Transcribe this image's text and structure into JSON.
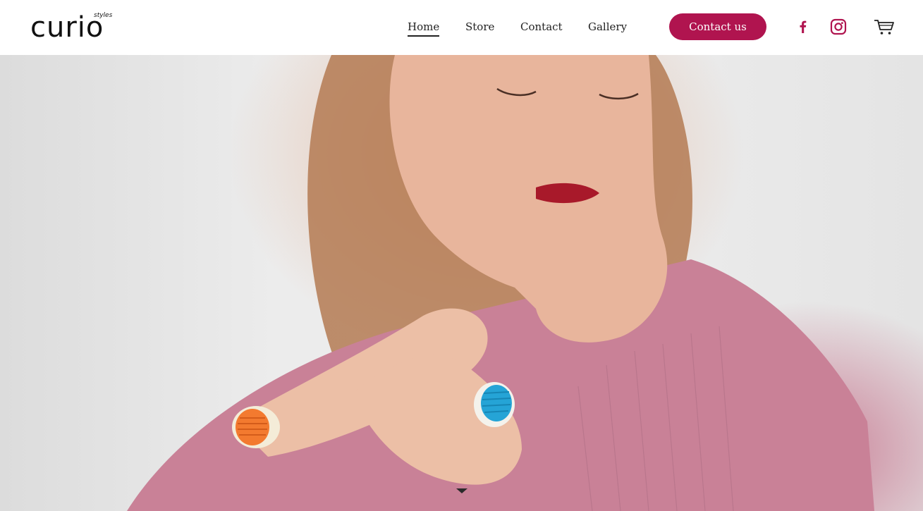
{
  "brand": {
    "logo_main": "curio",
    "logo_sub": "styles"
  },
  "nav": {
    "items": [
      {
        "label": "Home",
        "active": true
      },
      {
        "label": "Store",
        "active": false
      },
      {
        "label": "Contact",
        "active": false
      },
      {
        "label": "Gallery",
        "active": false
      }
    ]
  },
  "cta": {
    "label": "Contact us",
    "color": "#b0144f"
  },
  "social": {
    "icons": [
      "facebook-icon",
      "instagram-icon",
      "cart-icon"
    ]
  },
  "hero": {
    "image": "model-wearing-colorful-rings",
    "scroll_icon": "chevron-down-icon"
  }
}
